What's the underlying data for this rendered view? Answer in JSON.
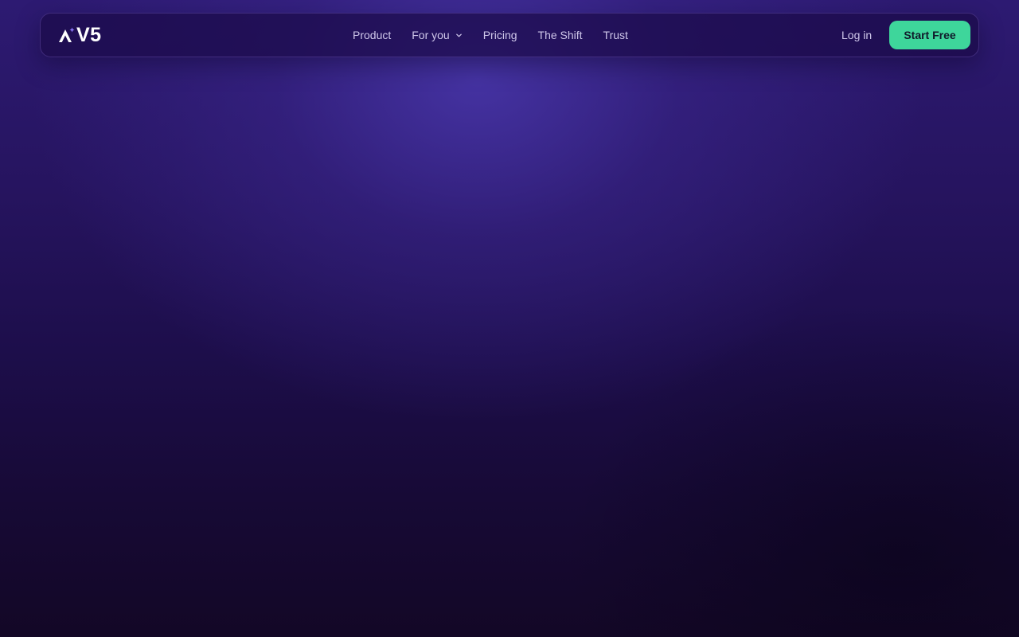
{
  "brand": {
    "logo_text": "V5",
    "logo_icon": "spark-triangle-logo-icon"
  },
  "nav": {
    "items": [
      {
        "label": "Product"
      },
      {
        "label": "For you",
        "icon": "chevron-down-icon"
      },
      {
        "label": "Pricing"
      },
      {
        "label": "The Shift"
      },
      {
        "label": "Trust"
      }
    ]
  },
  "actions": {
    "login_label": "Log in",
    "cta_label": "Start Free"
  },
  "colors": {
    "accent": "#3ed69b",
    "background_top": "#2d1a72",
    "background_bottom": "#130726",
    "nav_text": "#cfc7ea"
  }
}
